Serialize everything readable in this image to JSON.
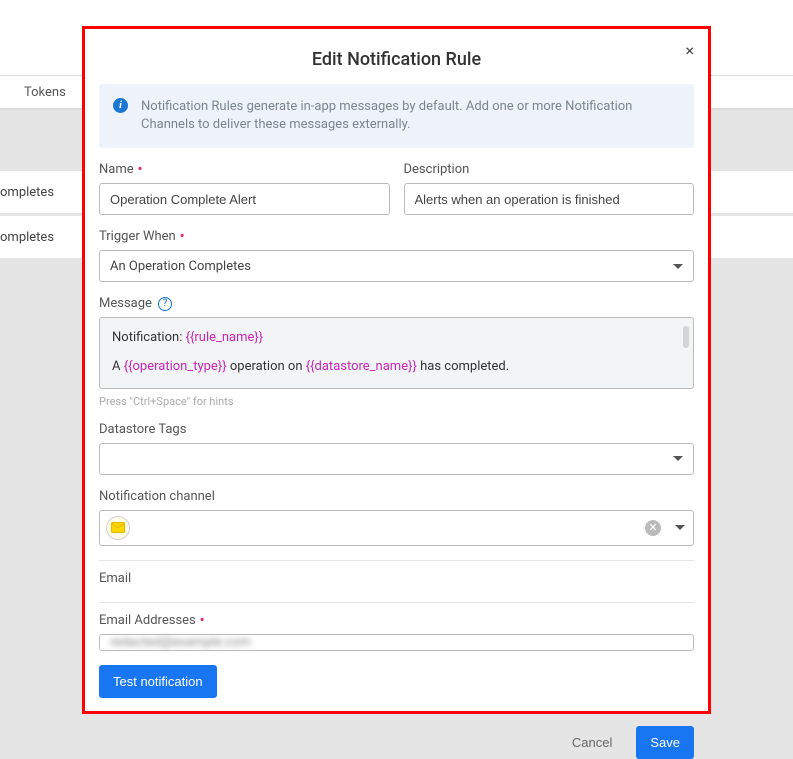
{
  "background": {
    "tokens_tab": "Tokens",
    "row_text": "ompletes"
  },
  "modal": {
    "title": "Edit Notification Rule",
    "close": "×",
    "info_banner": "Notification Rules generate in-app messages by default. Add one or more Notification Channels to deliver these messages externally.",
    "name_label": "Name",
    "name_value": "Operation Complete Alert",
    "description_label": "Description",
    "description_value": "Alerts when an operation is finished",
    "trigger_label": "Trigger When",
    "trigger_value": "An Operation Completes",
    "message_label": "Message",
    "message": {
      "line1_prefix": "Notification: ",
      "token_rule_name": "{{rule_name}}",
      "line2_a": "A ",
      "token_op_type": "{{operation_type}}",
      "line2_b": " operation on ",
      "token_ds_name": "{{datastore_name}}",
      "line2_c": " has completed."
    },
    "message_hint": "Press \"Ctrl+Space\" for hints",
    "datastore_tags_label": "Datastore Tags",
    "channel_label": "Notification channel",
    "email_section": "Email",
    "email_addresses_label": "Email Addresses",
    "email_addresses_value": "redacted@example.com",
    "test_button": "Test notification",
    "cancel": "Cancel",
    "save": "Save"
  }
}
